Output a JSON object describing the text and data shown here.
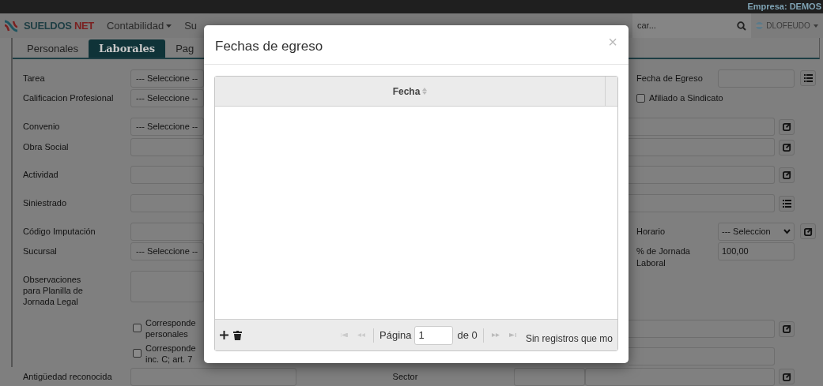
{
  "top_bar": {
    "company": "Empresa: DEMOS"
  },
  "nav": {
    "brand_a": "SUELDOS",
    "brand_b": "NET",
    "menus": [
      {
        "label": "Contabilidad",
        "caret": true
      },
      {
        "label": "Su",
        "caret": false
      }
    ],
    "search": {
      "placeholder": "car..."
    },
    "user": "DLOFEUDO"
  },
  "tabs": [
    {
      "label": "Personales",
      "selected": false
    },
    {
      "label": "Laborales",
      "selected": true
    },
    {
      "label": "Pag",
      "selected": false
    }
  ],
  "left_rows": [
    {
      "kind": "select",
      "label": "Tarea",
      "value": "--- Seleccione --"
    },
    {
      "kind": "select",
      "label": "Calificacion Profesional",
      "value": "--- Seleccione --"
    },
    {
      "kind": "select",
      "label": "Convenio",
      "value": "--- Seleccione --"
    },
    {
      "kind": "field",
      "label": "Obra Social"
    },
    {
      "kind": "field",
      "label": "Actividad"
    },
    {
      "kind": "field",
      "label": "Siniestrado"
    },
    {
      "kind": "field",
      "label": "Código Imputación"
    },
    {
      "kind": "select",
      "label": "Sucursal",
      "value": "--- Seleccione --"
    },
    {
      "kind": "textarea",
      "label": "Observaciones para Planilla de Jornada Legal"
    },
    {
      "kind": "checkbox",
      "text": "Corresponde",
      "text2": "personales",
      "checked": false
    },
    {
      "kind": "checkbox",
      "text": "Corresponde",
      "text2": "inc. C; art. 7",
      "checked": false
    }
  ],
  "right_rows": [
    {
      "kind": "labeled",
      "label": "Fecha de Egreso",
      "button": {
        "kind": "list"
      }
    },
    {
      "kind": "checkbox",
      "text": "Afiliado a Sindicato",
      "checked": false
    },
    {
      "kind": "wide",
      "button": {
        "kind": "external"
      }
    },
    {
      "kind": "wide",
      "button": {
        "kind": "external"
      }
    },
    {
      "kind": "wide",
      "button": {
        "kind": "external"
      }
    },
    {
      "kind": "wide",
      "button": {
        "kind": "list"
      }
    },
    {
      "kind": "select",
      "label": "Horario",
      "value": "--- Seleccion",
      "button": {
        "kind": "external"
      }
    },
    {
      "kind": "labeled",
      "label": "% de Jornada Laboral",
      "value": "100,00"
    },
    {
      "kind": "wide",
      "button": {
        "kind": "external"
      }
    },
    {
      "kind": "wide"
    }
  ],
  "bottom_row": {
    "label": "Antigüedad reconocida",
    "sector": "Sector"
  },
  "dialog": {
    "title": "Fechas de egreso",
    "close": "×",
    "columns": [
      {
        "label": "Fecha"
      }
    ],
    "pager": {
      "page_label": "Página",
      "page": "1",
      "of": "de 0",
      "status": "Sin registros que mo"
    }
  }
}
